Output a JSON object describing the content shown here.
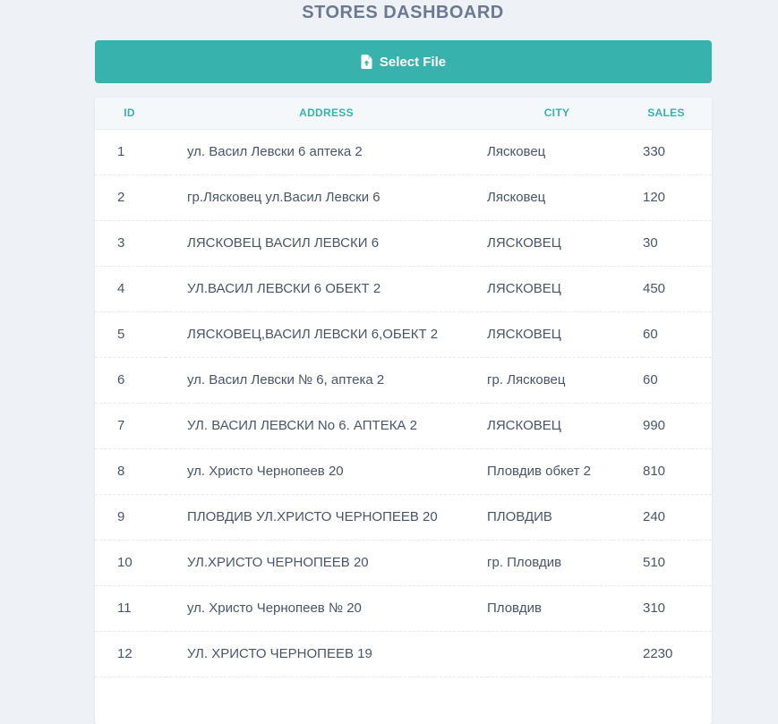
{
  "header": {
    "title": "STORES DASHBOARD"
  },
  "toolbar": {
    "select_file_label": "Select File",
    "select_file_icon": "file-upload-icon"
  },
  "table": {
    "columns": [
      "ID",
      "ADDRESS",
      "CITY",
      "SALES"
    ],
    "rows": [
      {
        "id": "1",
        "address": "ул. Васил Левски 6 аптека 2",
        "city": "Лясковец",
        "sales": "330"
      },
      {
        "id": "2",
        "address": "гр.Лясковец ул.Васил Левски 6",
        "city": "Лясковец",
        "sales": "120"
      },
      {
        "id": "3",
        "address": "ЛЯСКОВЕЦ ВАСИЛ ЛЕВСКИ 6",
        "city": "ЛЯСКОВЕЦ",
        "sales": "30"
      },
      {
        "id": "4",
        "address": "УЛ.ВАСИЛ ЛЕВСКИ 6 ОБЕКТ 2",
        "city": "ЛЯСКОВЕЦ",
        "sales": "450"
      },
      {
        "id": "5",
        "address": "ЛЯСКОВЕЦ,ВАСИЛ ЛЕВСКИ 6,ОБЕКТ 2",
        "city": "ЛЯСКОВЕЦ",
        "sales": "60"
      },
      {
        "id": "6",
        "address": "ул. Васил Левски № 6, аптека 2",
        "city": "гр. Лясковец",
        "sales": "60"
      },
      {
        "id": "7",
        "address": "УЛ. ВАСИЛ ЛЕВСКИ No 6. АПТЕКА 2",
        "city": "ЛЯСКОВЕЦ",
        "sales": "990"
      },
      {
        "id": "8",
        "address": "ул. Христо Чернопеев 20",
        "city": "Пловдив обкет 2",
        "sales": "810"
      },
      {
        "id": "9",
        "address": "ПЛОВДИВ УЛ.ХРИСТО ЧЕРНОПЕЕВ 20",
        "city": "ПЛОВДИВ",
        "sales": "240"
      },
      {
        "id": "10",
        "address": "УЛ.ХРИСТО ЧЕРНОПЕЕВ 20",
        "city": "гр. Пловдив",
        "sales": "510"
      },
      {
        "id": "11",
        "address": "ул. Христо Чернопеев № 20",
        "city": "Пловдив",
        "sales": "310"
      },
      {
        "id": "12",
        "address": "УЛ. ХРИСТО ЧЕРНОПЕЕВ 19",
        "city": "",
        "sales": "2230"
      }
    ]
  },
  "colors": {
    "accent": "#38b2ac",
    "title": "#6b7a90",
    "background": "#eef2f6",
    "text": "#4a5568"
  }
}
